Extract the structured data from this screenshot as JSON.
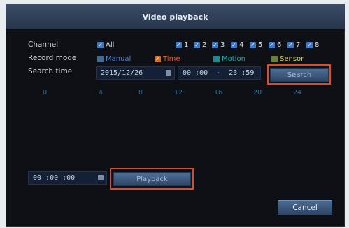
{
  "window": {
    "title": "Video playback"
  },
  "labels": {
    "channel": "Channel",
    "record_mode": "Record mode",
    "search_time": "Search time"
  },
  "channels": {
    "all_label": "All",
    "items": [
      "1",
      "2",
      "3",
      "4",
      "5",
      "6",
      "7",
      "8"
    ]
  },
  "record_modes": {
    "manual": "Manual",
    "time": "Time",
    "motion": "Motion",
    "sensor": "Sensor"
  },
  "search": {
    "date": "2015/12/26",
    "time_range": "00 :00  -  23 :59",
    "button": "Search"
  },
  "timeline_ticks": [
    "0",
    "4",
    "8",
    "12",
    "16",
    "20",
    "24"
  ],
  "playback": {
    "time": "00 :00 :00",
    "button": "Playback"
  },
  "footer": {
    "cancel": "Cancel"
  },
  "colors": {
    "accent": "#3b78c6",
    "highlight": "#e04b22",
    "manual": "#4a86d6",
    "time": "#e8552b",
    "motion": "#1db0b0",
    "sensor": "#d8d640"
  }
}
